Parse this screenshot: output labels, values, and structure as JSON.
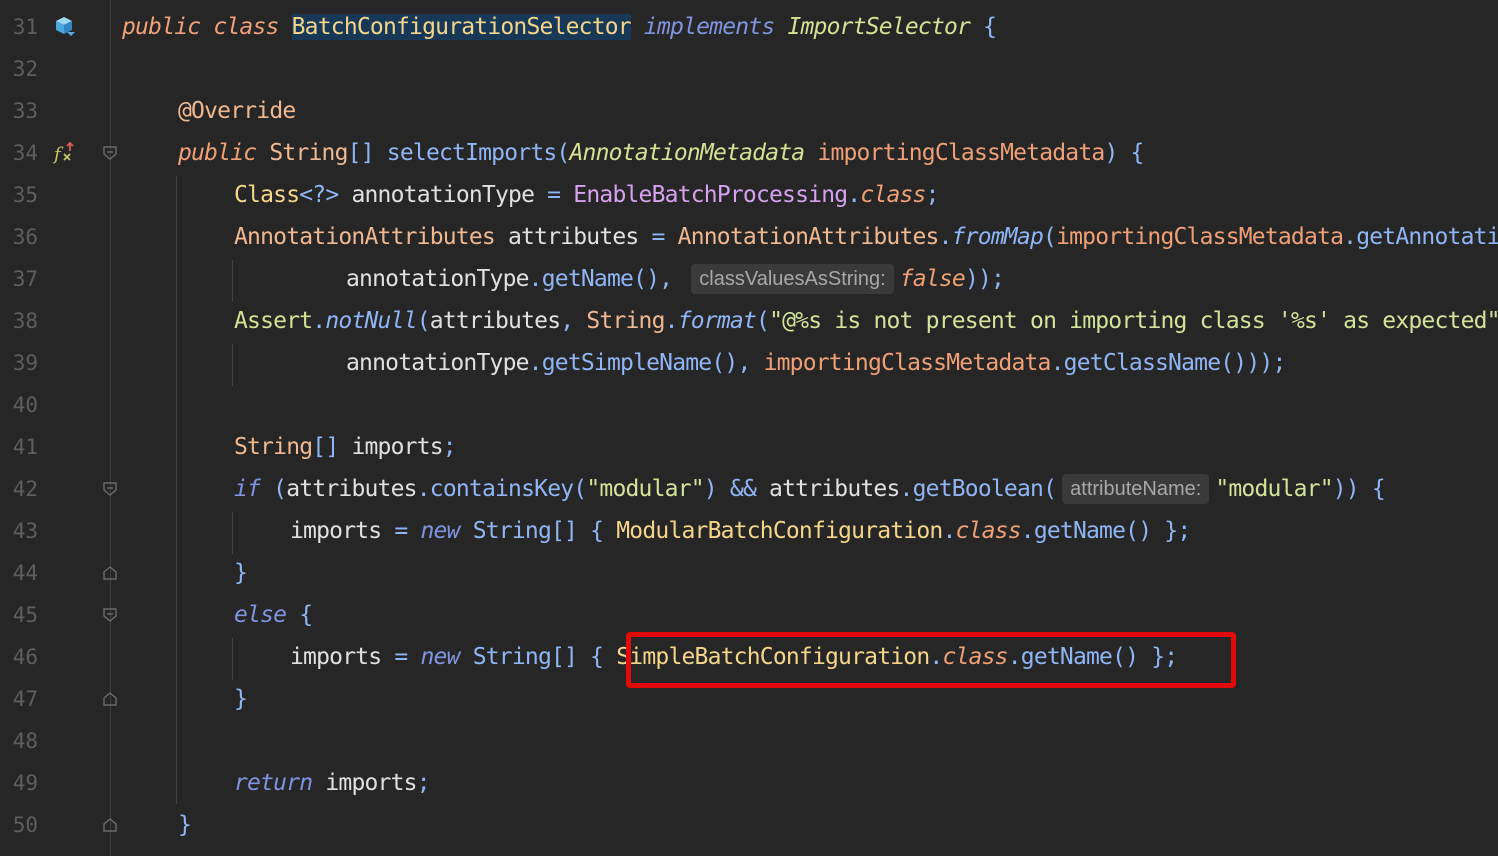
{
  "editor": {
    "lines": [
      {
        "num": "31",
        "tokens": [
          {
            "t": "public class ",
            "c": "kw"
          },
          {
            "t": "BatchConfigurationSelector",
            "c": "cls highlight"
          },
          {
            "t": " ",
            "c": "punc"
          },
          {
            "t": "implements ",
            "c": "kwb"
          },
          {
            "t": "ImportSelector",
            "c": "intf"
          },
          {
            "t": " {",
            "c": "paren"
          }
        ]
      },
      {
        "num": "32",
        "tokens": []
      },
      {
        "num": "33",
        "tokens": [
          {
            "t": "@Override",
            "c": "ann"
          }
        ]
      },
      {
        "num": "34",
        "tokens": [
          {
            "t": "public ",
            "c": "kw"
          },
          {
            "t": "String",
            "c": "type"
          },
          {
            "t": "[] ",
            "c": "paren"
          },
          {
            "t": "selectImports",
            "c": "meth"
          },
          {
            "t": "(",
            "c": "paren"
          },
          {
            "t": "AnnotationMetadata",
            "c": "intf"
          },
          {
            "t": " ",
            "c": "punc"
          },
          {
            "t": "importingClassMetadata",
            "c": "param"
          },
          {
            "t": ") {",
            "c": "paren"
          }
        ]
      },
      {
        "num": "35",
        "tokens": [
          {
            "t": "Class",
            "c": "cls"
          },
          {
            "t": "<?>",
            "c": "paren"
          },
          {
            "t": " annotationType ",
            "c": "punc"
          },
          {
            "t": "=",
            "c": "paren"
          },
          {
            "t": " ",
            "c": "punc"
          },
          {
            "t": "EnableBatchProcessing",
            "c": "cls2"
          },
          {
            "t": ".",
            "c": "paren"
          },
          {
            "t": "class",
            "c": "kw"
          },
          {
            "t": ";",
            "c": "paren"
          }
        ]
      },
      {
        "num": "36",
        "tokens": [
          {
            "t": "AnnotationAttributes",
            "c": "type"
          },
          {
            "t": " attributes ",
            "c": "punc"
          },
          {
            "t": "=",
            "c": "paren"
          },
          {
            "t": " ",
            "c": "punc"
          },
          {
            "t": "AnnotationAttributes",
            "c": "type"
          },
          {
            "t": ".",
            "c": "paren"
          },
          {
            "t": "fromMap",
            "c": "smeth"
          },
          {
            "t": "(",
            "c": "paren"
          },
          {
            "t": "importingClassMetadata",
            "c": "param"
          },
          {
            "t": ".",
            "c": "paren"
          },
          {
            "t": "getAnnotationAttributes",
            "c": "meth"
          },
          {
            "t": "(",
            "c": "paren"
          }
        ]
      },
      {
        "num": "37",
        "tokens": [
          {
            "t": "annotationType",
            "c": "punc"
          },
          {
            "t": ".",
            "c": "paren"
          },
          {
            "t": "getName",
            "c": "meth"
          },
          {
            "t": "(),",
            "c": "paren"
          },
          {
            "t": " ",
            "c": "punc"
          },
          {
            "hint": "classValuesAsString:"
          },
          {
            "t": "false",
            "c": "bool"
          },
          {
            "t": "));",
            "c": "paren"
          }
        ]
      },
      {
        "num": "38",
        "tokens": [
          {
            "t": "Assert",
            "c": "asrt"
          },
          {
            "t": ".",
            "c": "paren"
          },
          {
            "t": "notNull",
            "c": "smeth"
          },
          {
            "t": "(",
            "c": "paren"
          },
          {
            "t": "attributes",
            "c": "punc"
          },
          {
            "t": ", ",
            "c": "paren"
          },
          {
            "t": "String",
            "c": "type"
          },
          {
            "t": ".",
            "c": "paren"
          },
          {
            "t": "format",
            "c": "smeth"
          },
          {
            "t": "(",
            "c": "paren"
          },
          {
            "t": "\"@%s is not present on importing class '%s' as expected\"",
            "c": "str"
          }
        ]
      },
      {
        "num": "39",
        "tokens": [
          {
            "t": "annotationType",
            "c": "punc"
          },
          {
            "t": ".",
            "c": "paren"
          },
          {
            "t": "getSimpleName",
            "c": "meth"
          },
          {
            "t": "(), ",
            "c": "paren"
          },
          {
            "t": "importingClassMetadata",
            "c": "param"
          },
          {
            "t": ".",
            "c": "paren"
          },
          {
            "t": "getClassName",
            "c": "meth"
          },
          {
            "t": "()));",
            "c": "paren"
          }
        ]
      },
      {
        "num": "40",
        "tokens": []
      },
      {
        "num": "41",
        "tokens": [
          {
            "t": "String",
            "c": "type"
          },
          {
            "t": "[]",
            "c": "paren"
          },
          {
            "t": " imports",
            "c": "punc"
          },
          {
            "t": ";",
            "c": "paren"
          }
        ]
      },
      {
        "num": "42",
        "tokens": [
          {
            "t": "if",
            "c": "kwb"
          },
          {
            "t": " (",
            "c": "paren"
          },
          {
            "t": "attributes",
            "c": "punc"
          },
          {
            "t": ".",
            "c": "paren"
          },
          {
            "t": "containsKey",
            "c": "meth"
          },
          {
            "t": "(",
            "c": "paren"
          },
          {
            "t": "\"modular\"",
            "c": "str"
          },
          {
            "t": ") && ",
            "c": "paren"
          },
          {
            "t": "attributes",
            "c": "punc"
          },
          {
            "t": ".",
            "c": "paren"
          },
          {
            "t": "getBoolean",
            "c": "meth"
          },
          {
            "t": "(",
            "c": "paren"
          },
          {
            "hint": "attributeName:"
          },
          {
            "t": "\"modular\"",
            "c": "str"
          },
          {
            "t": ")) {",
            "c": "paren"
          }
        ]
      },
      {
        "num": "43",
        "tokens": [
          {
            "t": "imports ",
            "c": "punc"
          },
          {
            "t": "= ",
            "c": "paren"
          },
          {
            "t": "new ",
            "c": "kwb"
          },
          {
            "t": "String",
            "c": "meth"
          },
          {
            "t": "[] { ",
            "c": "paren"
          },
          {
            "t": "ModularBatchConfiguration",
            "c": "cls"
          },
          {
            "t": ".",
            "c": "paren"
          },
          {
            "t": "class",
            "c": "kw"
          },
          {
            "t": ".",
            "c": "paren"
          },
          {
            "t": "getName",
            "c": "meth"
          },
          {
            "t": "() };",
            "c": "paren"
          }
        ]
      },
      {
        "num": "44",
        "tokens": [
          {
            "t": "}",
            "c": "paren"
          }
        ]
      },
      {
        "num": "45",
        "tokens": [
          {
            "t": "else",
            "c": "kwb"
          },
          {
            "t": " {",
            "c": "paren"
          }
        ]
      },
      {
        "num": "46",
        "tokens": [
          {
            "t": "imports ",
            "c": "punc"
          },
          {
            "t": "= ",
            "c": "paren"
          },
          {
            "t": "new ",
            "c": "kwb"
          },
          {
            "t": "String",
            "c": "meth"
          },
          {
            "t": "[] { ",
            "c": "paren"
          },
          {
            "t": "SimpleBatchConfiguration",
            "c": "cls"
          },
          {
            "t": ".",
            "c": "paren"
          },
          {
            "t": "class",
            "c": "kw"
          },
          {
            "t": ".",
            "c": "paren"
          },
          {
            "t": "getName",
            "c": "meth"
          },
          {
            "t": "() };",
            "c": "paren"
          }
        ]
      },
      {
        "num": "47",
        "tokens": [
          {
            "t": "}",
            "c": "paren"
          }
        ]
      },
      {
        "num": "48",
        "tokens": []
      },
      {
        "num": "49",
        "tokens": [
          {
            "t": "return",
            "c": "ret"
          },
          {
            "t": " imports",
            "c": "punc"
          },
          {
            "t": ";",
            "c": "paren"
          }
        ]
      },
      {
        "num": "50",
        "tokens": [
          {
            "t": "}",
            "c": "paren"
          }
        ]
      }
    ]
  },
  "icons": {
    "line31": "class-implements-icon",
    "line34": "override-method-icon"
  },
  "colors": {
    "background": "#262626",
    "highlight_box": "#e20a0a",
    "selection": "#173957"
  }
}
